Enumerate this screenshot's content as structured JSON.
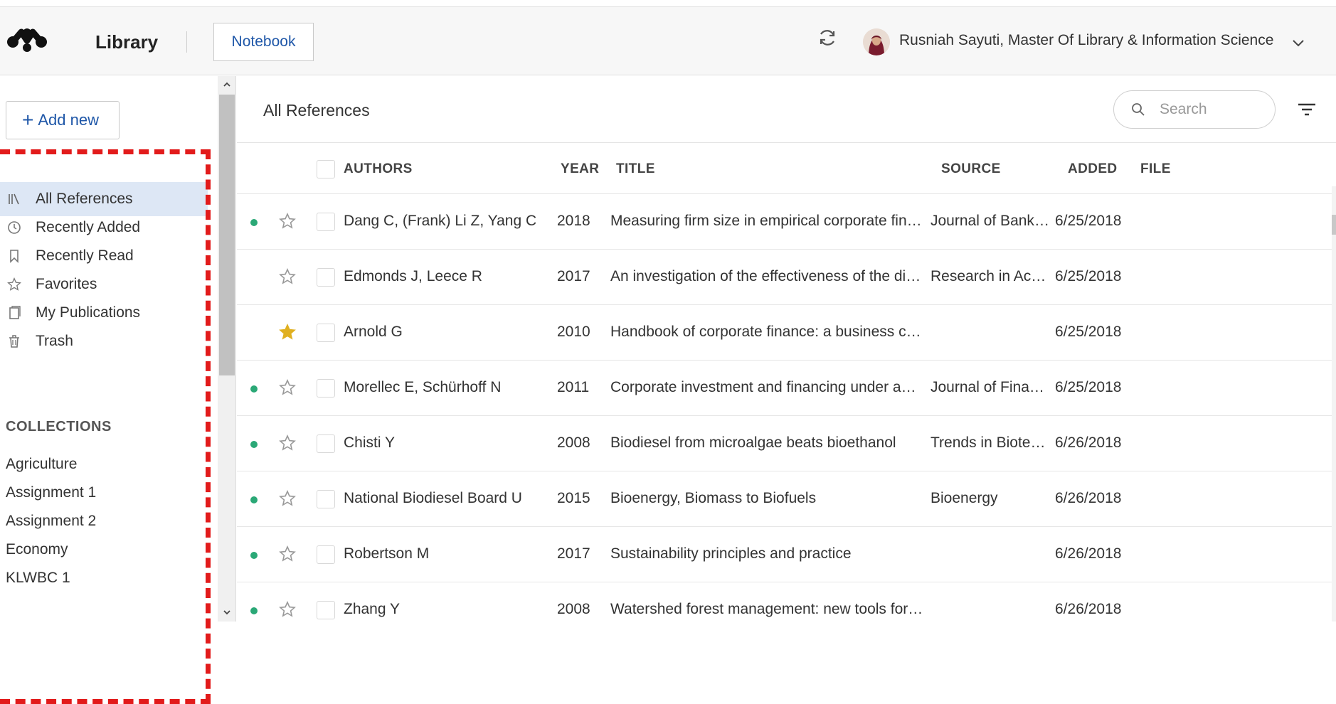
{
  "header": {
    "app_title": "Library",
    "notebook_label": "Notebook",
    "user_name": "Rusniah Sayuti, Master Of Library & Information Science"
  },
  "sidebar": {
    "add_new_label": "Add new",
    "nav": [
      {
        "label": "All References",
        "icon": "library-icon",
        "active": true
      },
      {
        "label": "Recently Added",
        "icon": "clock-icon"
      },
      {
        "label": "Recently Read",
        "icon": "bookmark-icon"
      },
      {
        "label": "Favorites",
        "icon": "star-icon"
      },
      {
        "label": "My Publications",
        "icon": "publications-icon"
      },
      {
        "label": "Trash",
        "icon": "trash-icon"
      }
    ],
    "collections_heading": "COLLECTIONS",
    "collections": [
      "Agriculture",
      "Assignment 1",
      "Assignment 2",
      "Economy",
      "KLWBC 1"
    ]
  },
  "main": {
    "title": "All References",
    "search_placeholder": "Search",
    "columns": {
      "authors": "AUTHORS",
      "year": "YEAR",
      "title": "TITLE",
      "source": "SOURCE",
      "added": "ADDED",
      "file": "FILE"
    },
    "rows": [
      {
        "unread": true,
        "favorite": false,
        "authors": "Dang C, (Frank) Li Z, Yang C",
        "year": "2018",
        "title": "Measuring firm size in empirical corporate finance",
        "source": "Journal of Banki…",
        "added": "6/25/2018"
      },
      {
        "unread": false,
        "favorite": false,
        "authors": "Edmonds J, Leece R",
        "year": "2017",
        "title": "An investigation of the effectiveness of the division …",
        "source": "Research in Acc…",
        "added": "6/25/2018"
      },
      {
        "unread": false,
        "favorite": true,
        "authors": "Arnold G",
        "year": "2010",
        "title": "Handbook of corporate finance: a business compani…",
        "source": "",
        "added": "6/25/2018"
      },
      {
        "unread": true,
        "favorite": false,
        "authors": "Morellec E, Schürhoff N",
        "year": "2011",
        "title": "Corporate investment and financing under asymmet…",
        "source": "Journal of Financ…",
        "added": "6/25/2018"
      },
      {
        "unread": true,
        "favorite": false,
        "authors": "Chisti Y",
        "year": "2008",
        "title": "Biodiesel from microalgae beats bioethanol",
        "source": "Trends in Biotec…",
        "added": "6/26/2018"
      },
      {
        "unread": true,
        "favorite": false,
        "authors": "National Biodiesel Board U",
        "year": "2015",
        "title": "Bioenergy, Biomass to Biofuels",
        "source": "Bioenergy",
        "added": "6/26/2018"
      },
      {
        "unread": true,
        "favorite": false,
        "authors": "Robertson M",
        "year": "2017",
        "title": "Sustainability principles and practice",
        "source": "",
        "added": "6/26/2018"
      },
      {
        "unread": true,
        "favorite": false,
        "authors": "Zhang Y",
        "year": "2008",
        "title": "Watershed forest management: new tools for water …",
        "source": "",
        "added": "6/26/2018"
      }
    ]
  },
  "colors": {
    "accent_blue": "#1f57a8",
    "active_nav_bg": "#dde7f5",
    "unread_dot": "#2aa876",
    "favorite_star": "#e0b020",
    "annotation_red": "#e21b1b"
  }
}
